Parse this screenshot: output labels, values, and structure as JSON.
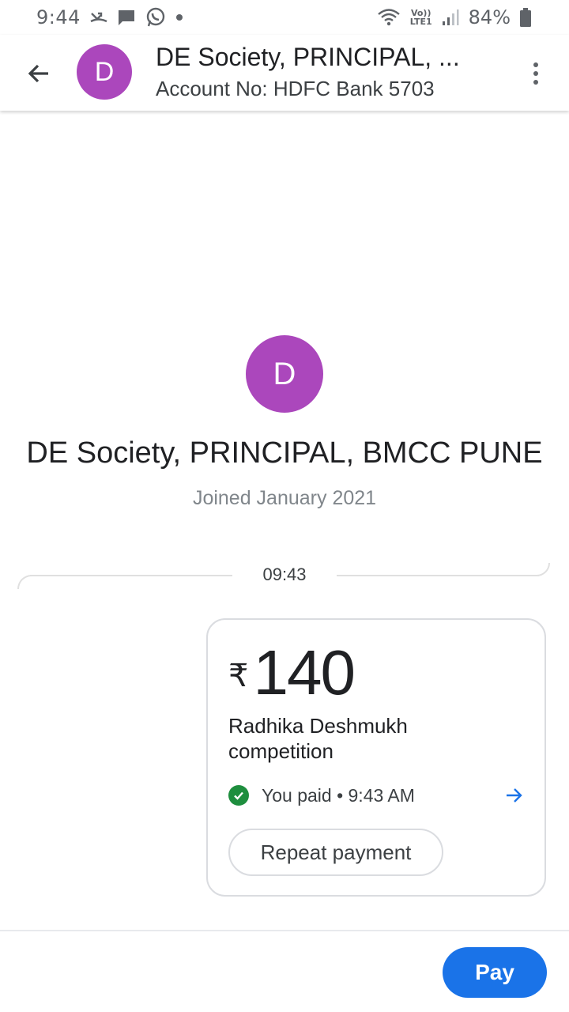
{
  "status_bar": {
    "time": "9:44",
    "battery_percent": "84%",
    "network_label_top": "Vo))",
    "network_label_bottom": "LTE1",
    "icons": [
      "missed-call-icon",
      "message-icon",
      "whatsapp-icon",
      "notification-dot-icon",
      "wifi-icon",
      "signal-icon",
      "battery-icon"
    ]
  },
  "header": {
    "avatar_letter": "D",
    "title": "DE Society, PRINCIPAL, ...",
    "subtitle": "Account No: HDFC Bank 5703",
    "avatar_color": "#ab47bc"
  },
  "profile": {
    "avatar_letter": "D",
    "name": "DE Society, PRINCIPAL, BMCC PUNE",
    "joined": "Joined January 2021"
  },
  "conversation": {
    "divider_time": "09:43",
    "payment": {
      "currency_symbol": "₹",
      "amount": "140",
      "note": "Radhika Deshmukh competition",
      "status": "You paid • 9:43 AM",
      "status_color": "#1e8e3e",
      "repeat_label": "Repeat payment"
    }
  },
  "footer": {
    "pay_label": "Pay",
    "accent_color": "#1a73e8"
  }
}
